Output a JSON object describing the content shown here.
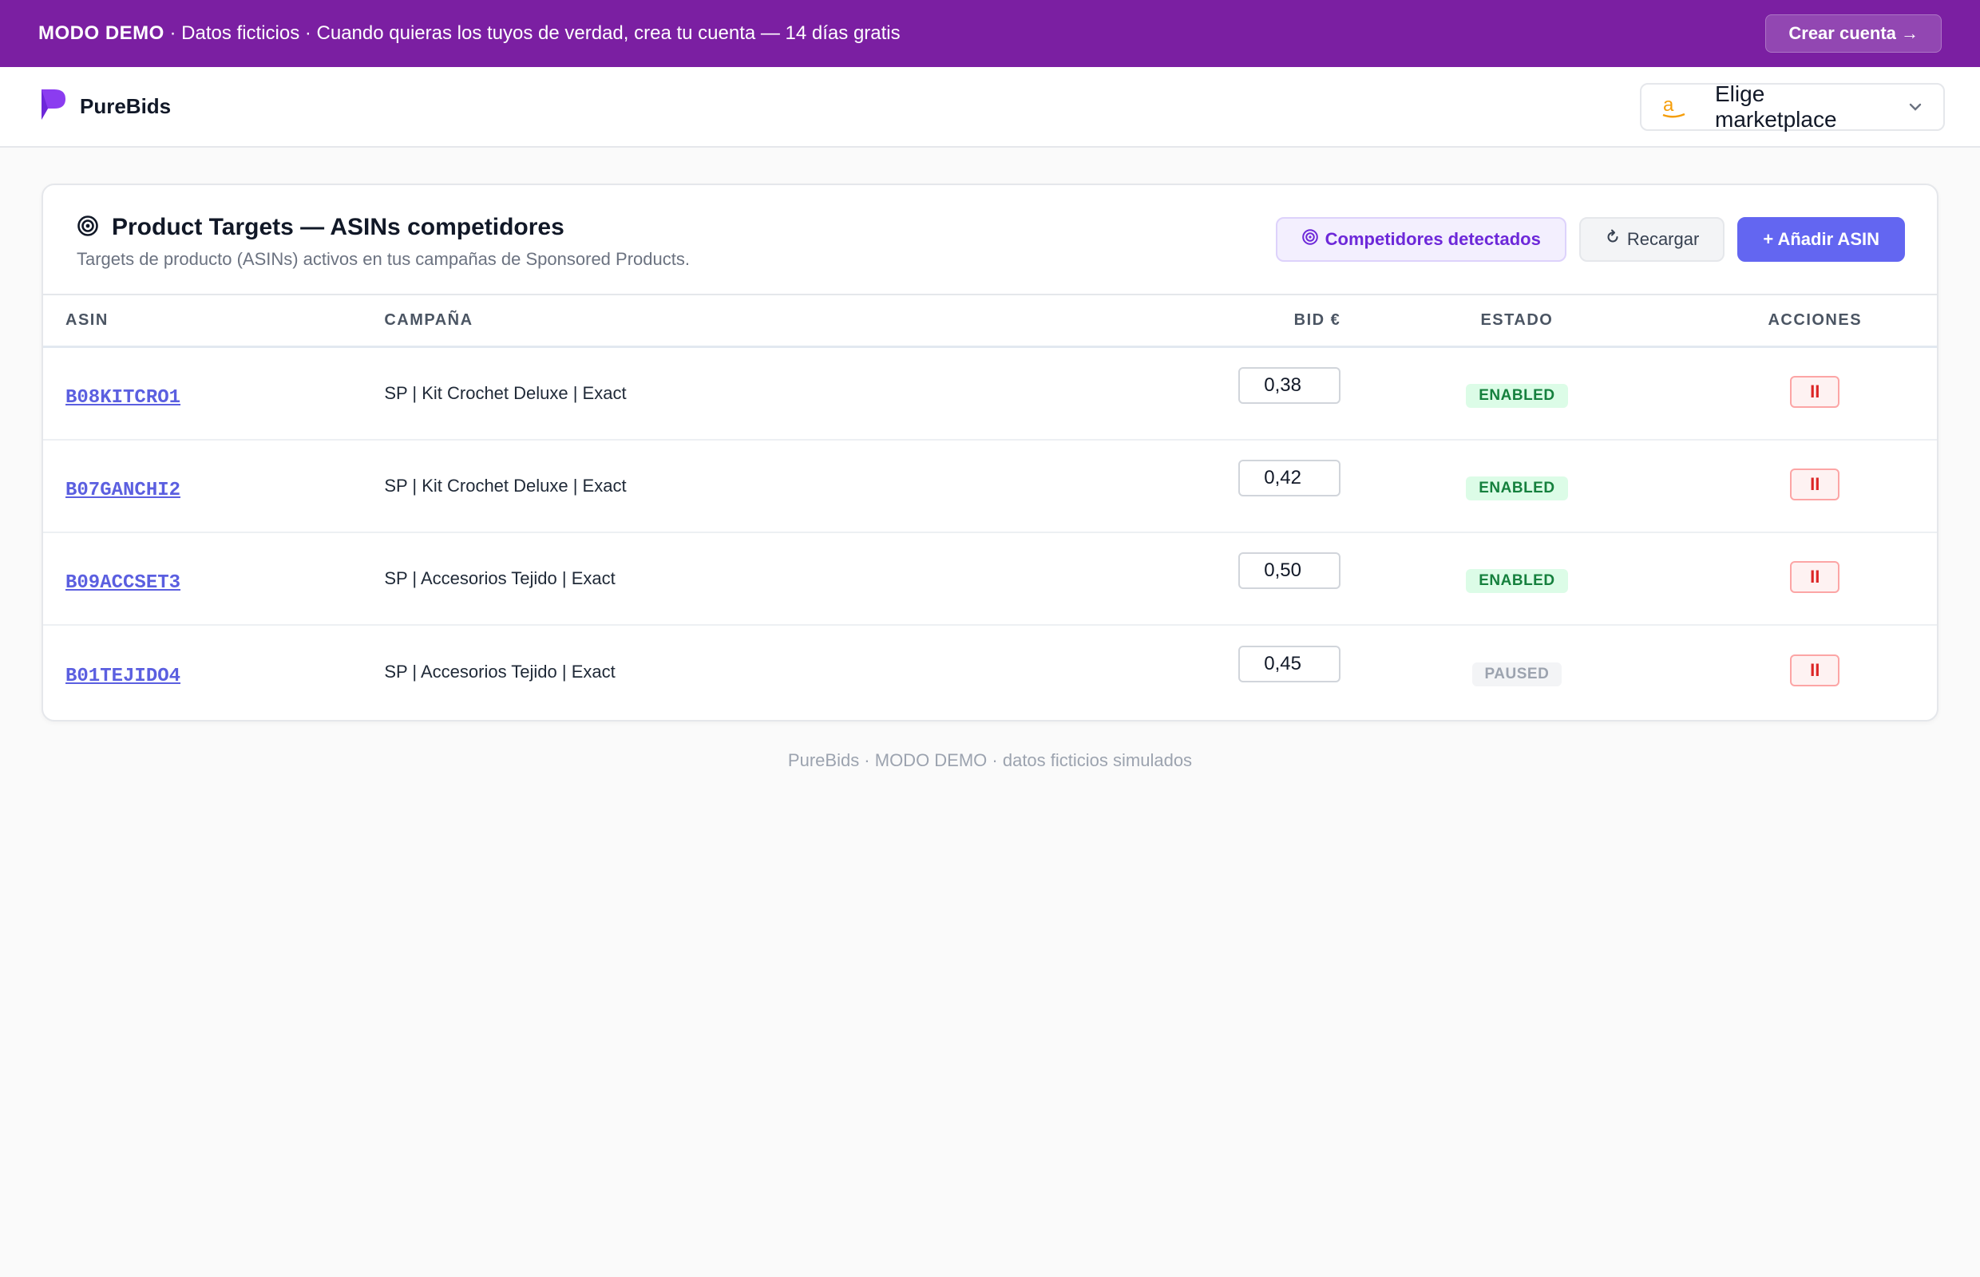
{
  "banner": {
    "label_strong": "MODO DEMO",
    "text": " · Datos ficticios · Cuando quieras los tuyos de verdad, crea tu cuenta — 14 días gratis",
    "cta": "Crear cuenta →"
  },
  "nav": {
    "brand": "PureBids",
    "marketplace_placeholder": "Elige marketplace",
    "marketplace_icon": "amazon-icon"
  },
  "card": {
    "title": "Product Targets — ASINs competidores",
    "subtitle": "Targets de producto (ASINs) activos en tus campañas de Sponsored Products.",
    "buttons": {
      "competitors": "Competidores detectados",
      "reload": "Recargar",
      "add": "+ Añadir ASIN"
    }
  },
  "table": {
    "headers": {
      "asin": "ASIN",
      "campaign": "CAMPAÑA",
      "bid": "BID €",
      "status": "ESTADO",
      "actions": "ACCIONES"
    },
    "rows": [
      {
        "asin": "B08KITCRO1",
        "campaign": "SP | Kit Crochet Deluxe | Exact",
        "bid": "0,38",
        "status": "ENABLED",
        "action": "II"
      },
      {
        "asin": "B07GANCHI2",
        "campaign": "SP | Kit Crochet Deluxe | Exact",
        "bid": "0,42",
        "status": "ENABLED",
        "action": "II"
      },
      {
        "asin": "B09ACCSET3",
        "campaign": "SP | Accesorios Tejido | Exact",
        "bid": "0,50",
        "status": "ENABLED",
        "action": "II"
      },
      {
        "asin": "B01TEJIDO4",
        "campaign": "SP | Accesorios Tejido | Exact",
        "bid": "0,45",
        "status": "PAUSED",
        "action": "II"
      }
    ]
  },
  "footer": "PureBids · MODO DEMO · datos ficticios simulados",
  "colors": {
    "banner": "#7b1fa2",
    "accent": "#6366f1",
    "enabled": "#15803d",
    "paused": "#9ca3af",
    "danger": "#dc2626"
  }
}
